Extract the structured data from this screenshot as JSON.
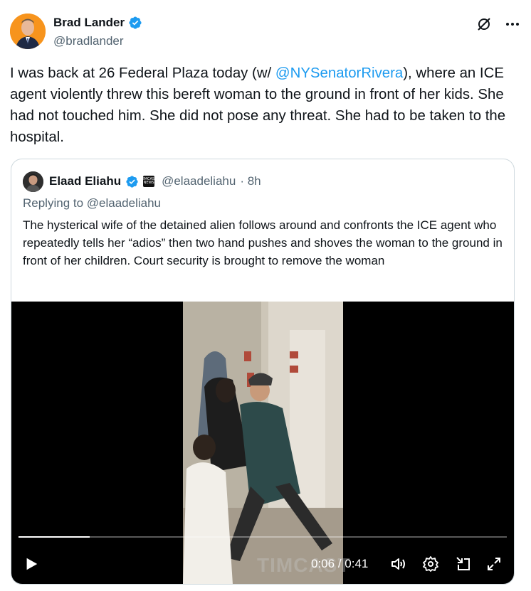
{
  "post": {
    "author_name": "Brad Lander",
    "author_handle": "@bradlander",
    "text_before": "I was back at 26 Federal Plaza today (w/ ",
    "mention": "@NYSenatorRivera",
    "text_after": "), where an ICE agent violently threw this bereft woman to the ground in front of her kids. She had not touched him. She did not pose any threat. She had to be taken to the hospital."
  },
  "quote": {
    "author_name": "Elaad Eliahu",
    "author_handle": "@elaadeliahu",
    "time": "· 8h",
    "replying_to": "Replying to @elaadeliahu",
    "text": "The hysterical wife of the detained alien follows around and confronts the ICE agent who repeatedly tells her “adios” then two hand pushes and shoves the woman to the ground in front of her children. Court security is brought to remove the woman",
    "badge_text": "TIMCAST NEWS"
  },
  "video": {
    "current_time": "0:06",
    "separator": " / ",
    "duration": "0:41",
    "progress": 0.146,
    "watermark": "TIMCAST"
  },
  "colors": {
    "link": "#1d9bf0",
    "verified": "#1d9bf0",
    "secondary_text": "#536471",
    "border": "#cfd9de"
  },
  "icons": [
    "verified-badge-icon",
    "grok-icon",
    "more-icon",
    "play-icon",
    "volume-icon",
    "settings-icon",
    "pip-icon",
    "fullscreen-icon"
  ]
}
